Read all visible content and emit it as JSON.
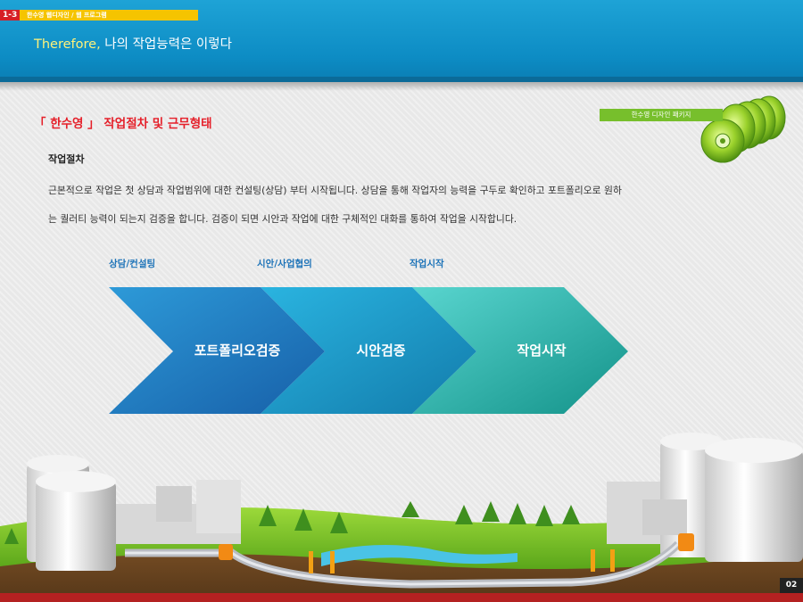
{
  "header": {
    "badge_number": "1-3",
    "badge_text": "한수영 웹디자인 / 웹 프로그램",
    "title_accent": "Therefore,",
    "title_rest": " 나의 작업능력은 이렇다"
  },
  "section": {
    "title": "「 한수영 」 작업절차 및 근무형태",
    "subtitle": "작업절차",
    "paragraph_line1": "근본적으로 작업은 첫 상담과 작업범위에 대한 컨설팅(상담) 부터 시작됩니다. 상담을 통해 작업자의 능력을 구두로 확인하고 포트폴리오로 원하",
    "paragraph_line2": "는 퀄러티 능력이 되는지 검증을 합니다. 검증이 되면 시안과 작업에 대한 구체적인 대화를 통하여 작업을 시작합니다."
  },
  "package_badge": "한수영 디자인 패키지",
  "process": {
    "labels": [
      "상담/컨설팅",
      "시안/사업협의",
      "작업시작"
    ],
    "steps": [
      "포트폴리오검증",
      "시안검증",
      "작업시작"
    ]
  },
  "colors": {
    "header_blue": "#0d8cc4",
    "title_red": "#e5202a",
    "label_blue": "#1d73b8",
    "accent_yellow": "#fff27a",
    "badge_red": "#d61f26",
    "badge_yellow": "#f5c400",
    "package_green": "#77bf2c"
  },
  "page_number": "02"
}
